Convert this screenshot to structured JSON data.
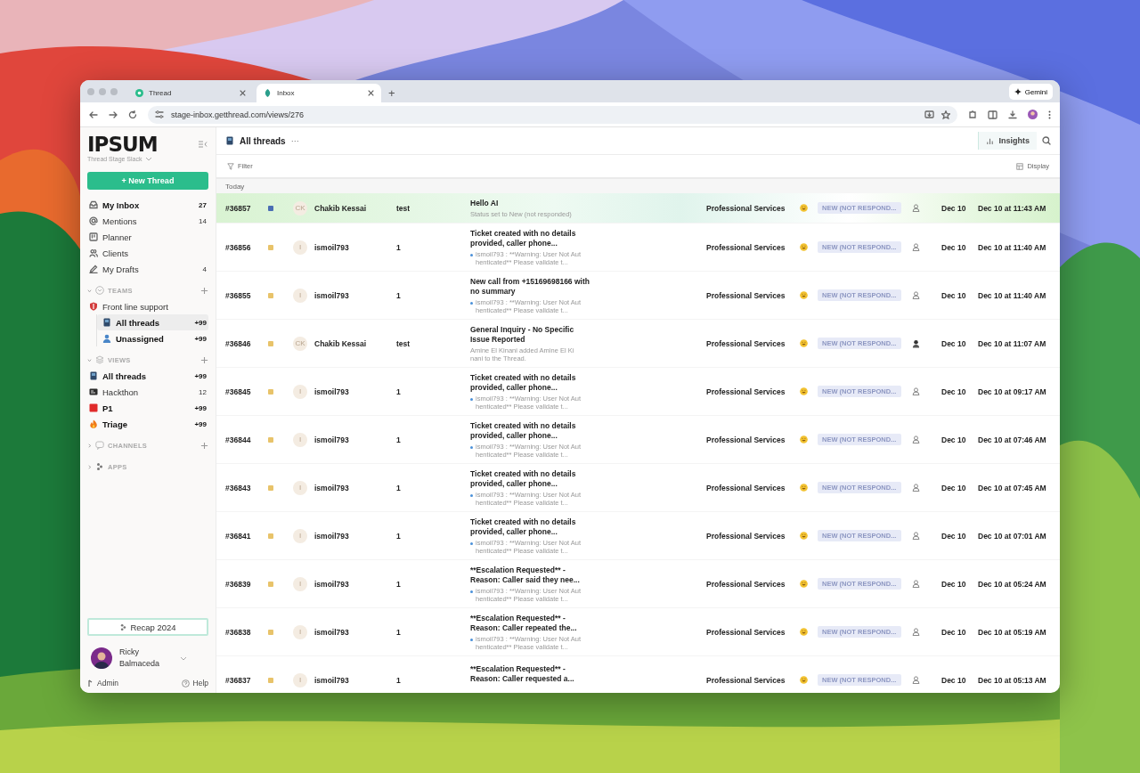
{
  "browser": {
    "tabs": [
      {
        "title": "Thread",
        "selected": false
      },
      {
        "title": "Inbox",
        "selected": true
      }
    ],
    "new_tab": "+",
    "gemini": "Gemini",
    "url": "stage-inbox.getthread.com/views/276"
  },
  "sidebar": {
    "logo": "IPSUM",
    "workspace": "Thread Stage Slack",
    "new_button": "+ New Thread",
    "nav": [
      {
        "label": "My Inbox",
        "count": "27",
        "unread": true,
        "kind": "inbox"
      },
      {
        "label": "Mentions",
        "count": "14",
        "unread": false,
        "kind": "at"
      },
      {
        "label": "Planner",
        "unread": false,
        "kind": "planner"
      },
      {
        "label": "Clients",
        "unread": false,
        "kind": "clients"
      },
      {
        "label": "My Drafts",
        "count": "4",
        "unread": false,
        "kind": "pen"
      }
    ],
    "sections": [
      {
        "title": "TEAMS",
        "expanded": true,
        "addable": true,
        "kind": "teams",
        "children": [
          {
            "label": "Front line support",
            "kind": "shield",
            "children": [
              {
                "label": "All threads",
                "count": "+99",
                "selected": true,
                "unread": true,
                "kind": "book"
              },
              {
                "label": "Unassigned",
                "count": "+99",
                "selected": false,
                "unread": true,
                "kind": "person"
              }
            ]
          }
        ]
      },
      {
        "title": "VIEWS",
        "expanded": true,
        "addable": true,
        "kind": "views",
        "children": [
          {
            "label": "All threads",
            "count": "+99",
            "selected": false,
            "unread": true,
            "kind": "book"
          },
          {
            "label": "Hackthon",
            "count": "12",
            "selected": false,
            "unread": false,
            "kind": "board"
          },
          {
            "label": "P1",
            "count": "+99",
            "selected": false,
            "unread": true,
            "kind": "square"
          },
          {
            "label": "Triage",
            "count": "+99",
            "selected": false,
            "unread": true,
            "kind": "fire"
          }
        ]
      },
      {
        "title": "CHANNELS",
        "expanded": false,
        "addable": true,
        "kind": "channels"
      },
      {
        "title": "APPS",
        "expanded": false,
        "addable": false,
        "kind": "apps"
      }
    ],
    "recap_button": "Recap 2024",
    "user": "Ricky Balmaceda",
    "admin": "Admin",
    "help": "Help"
  },
  "main": {
    "title": "All threads",
    "more": "···",
    "insights": "Insights",
    "filter": "Filter",
    "display": "Display",
    "group": "Today",
    "rows": [
      {
        "id": "#36857",
        "color": "#4a6db3",
        "initials": "CK",
        "name": "Chakib Kessai",
        "column_4": "test",
        "title": "Hello AI",
        "preview": "Status set to New (not responded)",
        "unread": false,
        "category": "Professional Services",
        "status": "NEW (NOT RESPOND...",
        "assigned": false,
        "date": "Dec 10",
        "time": "Dec 10 at 11:43 AM",
        "selected": true
      },
      {
        "id": "#36856",
        "color": "#e8c36a",
        "initials": "I",
        "name": "ismoil793",
        "column_4": "1",
        "title": "Ticket created with no details provided, caller phone...",
        "preview": "ismoil793 : **Warning: User Not Authenticated** Please validate t...",
        "unread": true,
        "category": "Professional Services",
        "status": "NEW (NOT RESPOND...",
        "assigned": false,
        "date": "Dec 10",
        "time": "Dec 10 at 11:40 AM",
        "selected": false
      },
      {
        "id": "#36855",
        "color": "#e8c36a",
        "initials": "I",
        "name": "ismoil793",
        "column_4": "1",
        "title": "New call from +15169698166 with no summary",
        "preview": "ismoil793 : **Warning: User Not Authenticated** Please validate t...",
        "unread": true,
        "category": "Professional Services",
        "status": "NEW (NOT RESPOND...",
        "assigned": false,
        "date": "Dec 10",
        "time": "Dec 10 at 11:40 AM",
        "selected": false
      },
      {
        "id": "#36846",
        "color": "#e8c36a",
        "initials": "CK",
        "name": "Chakib Kessai",
        "column_4": "test",
        "title": "General Inquiry - No Specific Issue Reported",
        "preview": "Amine El Kinani added Amine El Kinani to the Thread.",
        "unread": false,
        "category": "Professional Services",
        "status": "NEW (NOT RESPOND...",
        "assigned": true,
        "date": "Dec 10",
        "time": "Dec 10 at 11:07 AM",
        "selected": false
      },
      {
        "id": "#36845",
        "color": "#e8c36a",
        "initials": "I",
        "name": "ismoil793",
        "column_4": "1",
        "title": "Ticket created with no details provided, caller phone...",
        "preview": "ismoil793 : **Warning: User Not Authenticated** Please validate t...",
        "unread": true,
        "category": "Professional Services",
        "status": "NEW (NOT RESPOND...",
        "assigned": false,
        "date": "Dec 10",
        "time": "Dec 10 at 09:17 AM",
        "selected": false
      },
      {
        "id": "#36844",
        "color": "#e8c36a",
        "initials": "I",
        "name": "ismoil793",
        "column_4": "1",
        "title": "Ticket created with no details provided, caller phone...",
        "preview": "ismoil793 : **Warning: User Not Authenticated** Please validate t...",
        "unread": true,
        "category": "Professional Services",
        "status": "NEW (NOT RESPOND...",
        "assigned": false,
        "date": "Dec 10",
        "time": "Dec 10 at 07:46 AM",
        "selected": false
      },
      {
        "id": "#36843",
        "color": "#e8c36a",
        "initials": "I",
        "name": "ismoil793",
        "column_4": "1",
        "title": "Ticket created with no details provided, caller phone...",
        "preview": "ismoil793 : **Warning: User Not Authenticated** Please validate t...",
        "unread": true,
        "category": "Professional Services",
        "status": "NEW (NOT RESPOND...",
        "assigned": false,
        "date": "Dec 10",
        "time": "Dec 10 at 07:45 AM",
        "selected": false
      },
      {
        "id": "#36841",
        "color": "#e8c36a",
        "initials": "I",
        "name": "ismoil793",
        "column_4": "1",
        "title": "Ticket created with no details provided, caller phone...",
        "preview": "ismoil793 : **Warning: User Not Authenticated** Please validate t...",
        "unread": true,
        "category": "Professional Services",
        "status": "NEW (NOT RESPOND...",
        "assigned": false,
        "date": "Dec 10",
        "time": "Dec 10 at 07:01 AM",
        "selected": false
      },
      {
        "id": "#36839",
        "color": "#e8c36a",
        "initials": "I",
        "name": "ismoil793",
        "column_4": "1",
        "title": "**Escalation Requested** - Reason: Caller said they nee...",
        "preview": "ismoil793 : **Warning: User Not Authenticated** Please validate t...",
        "unread": true,
        "category": "Professional Services",
        "status": "NEW (NOT RESPOND...",
        "assigned": false,
        "date": "Dec 10",
        "time": "Dec 10 at 05:24 AM",
        "selected": false
      },
      {
        "id": "#36838",
        "color": "#e8c36a",
        "initials": "I",
        "name": "ismoil793",
        "column_4": "1",
        "title": "**Escalation Requested** - Reason: Caller repeated the...",
        "preview": "ismoil793 : **Warning: User Not Authenticated** Please validate t...",
        "unread": true,
        "category": "Professional Services",
        "status": "NEW (NOT RESPOND...",
        "assigned": false,
        "date": "Dec 10",
        "time": "Dec 10 at 05:19 AM",
        "selected": false
      },
      {
        "id": "#36837",
        "color": "#e8c36a",
        "initials": "I",
        "name": "ismoil793",
        "column_4": "1",
        "title": "**Escalation Requested** - Reason: Caller requested a...",
        "category": "Professional Services",
        "status": "NEW (NOT RESPOND...",
        "assigned": false,
        "date": "Dec 10",
        "time": "Dec 10 at 05:13 AM",
        "selected": false
      }
    ]
  }
}
